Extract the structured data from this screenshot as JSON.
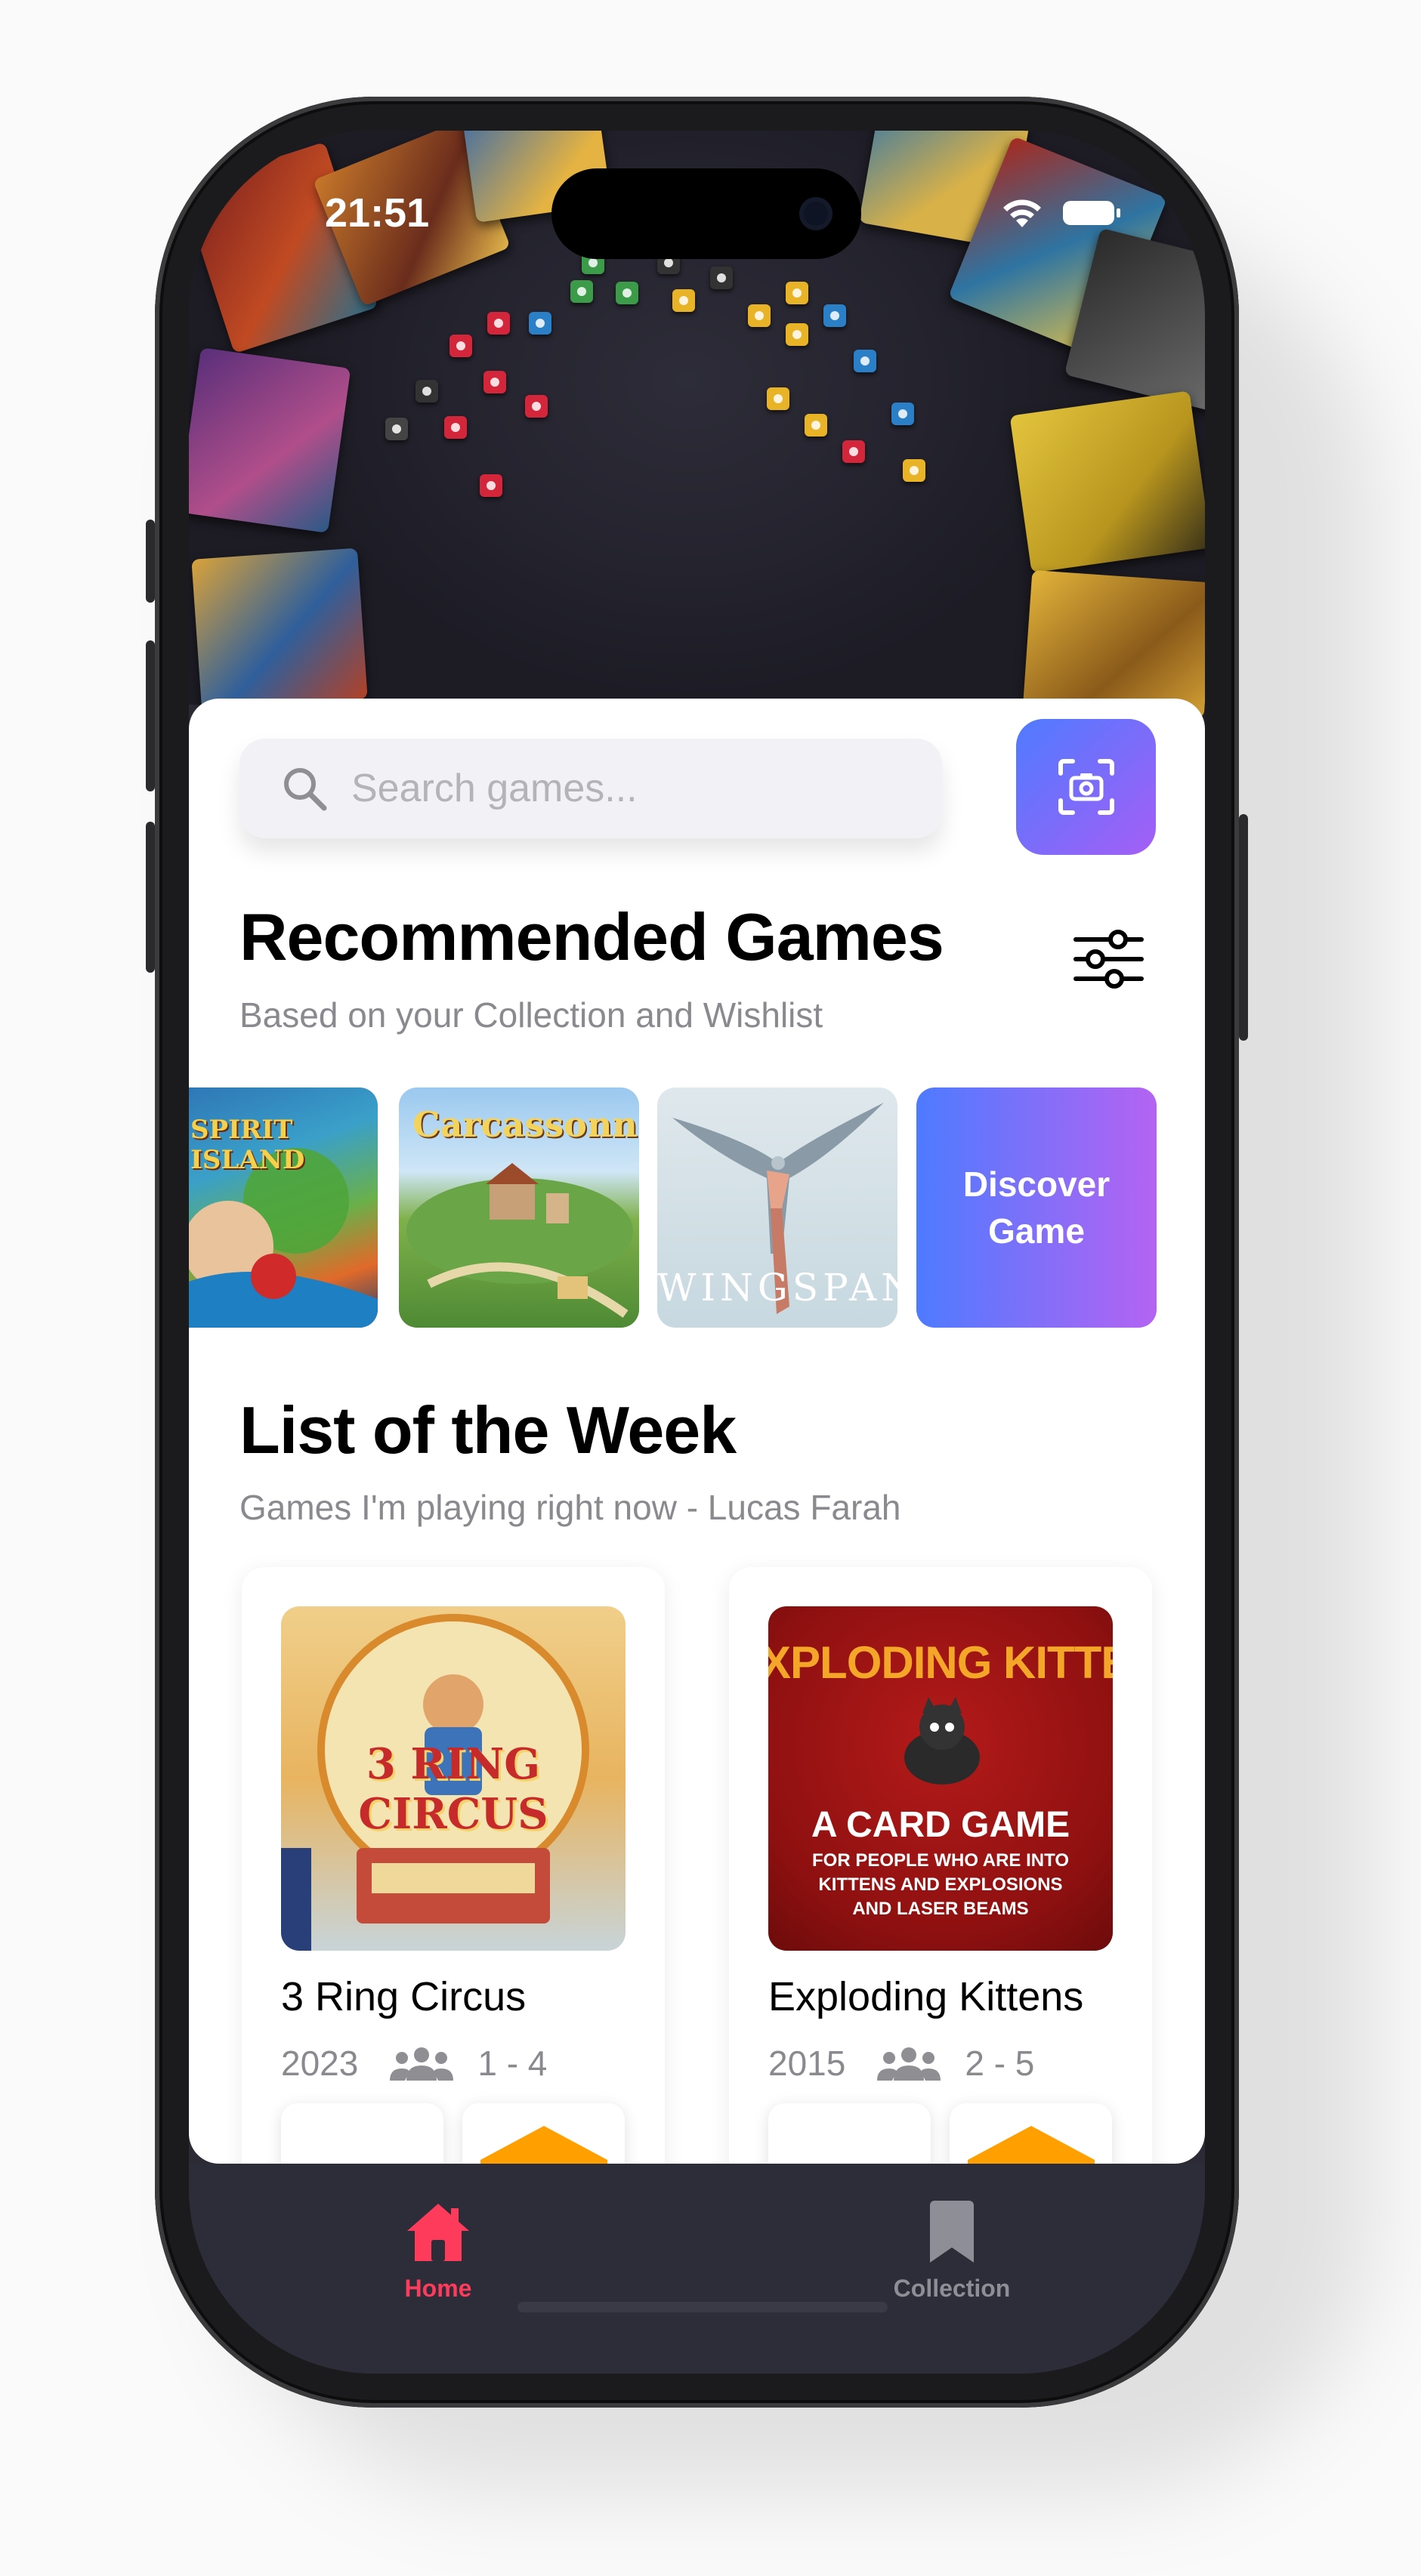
{
  "status_bar": {
    "time": "21:51"
  },
  "search": {
    "placeholder": "Search games..."
  },
  "recommended": {
    "title": "Recommended Games",
    "subtitle": "Based on your Collection and Wishlist",
    "games": [
      {
        "name": "Spirit Island",
        "cover_text": "SPIRIT ISLAND"
      },
      {
        "name": "Carcassonne",
        "cover_text": "Carcassonne"
      },
      {
        "name": "Wingspan",
        "cover_text": "WINGSPAN"
      }
    ],
    "discover_label_line1": "Discover",
    "discover_label_line2": "Game"
  },
  "week": {
    "title": "List of the Week",
    "subtitle": "Games I'm playing right now - Lucas Farah",
    "items": [
      {
        "name": "3 Ring Circus",
        "year": "2023",
        "players": "1 - 4",
        "cover_text_1": "3 RING",
        "cover_text_2": "CIRCUS"
      },
      {
        "name": "Exploding Kittens",
        "year": "2015",
        "players": "2 - 5",
        "cover_text_1": "XPLODING KITTE",
        "cover_text_2": "A CARD GAME",
        "cover_text_3": "FOR PEOPLE WHO ARE INTO",
        "cover_text_4": "KITTENS AND EXPLOSIONS",
        "cover_text_5": "AND LASER BEAMS"
      }
    ]
  },
  "tabs": [
    {
      "label": "Home",
      "icon": "house-icon",
      "active": true,
      "color": "#ff3b5c"
    },
    {
      "label": "Collection",
      "icon": "bookmark-icon",
      "active": false,
      "color": "#8e8e96"
    }
  ],
  "colors": {
    "accent": "#ff3b5c",
    "gradient_start": "#4f7bff",
    "gradient_end": "#a55ef6",
    "tab_background": "#2d2c39"
  }
}
